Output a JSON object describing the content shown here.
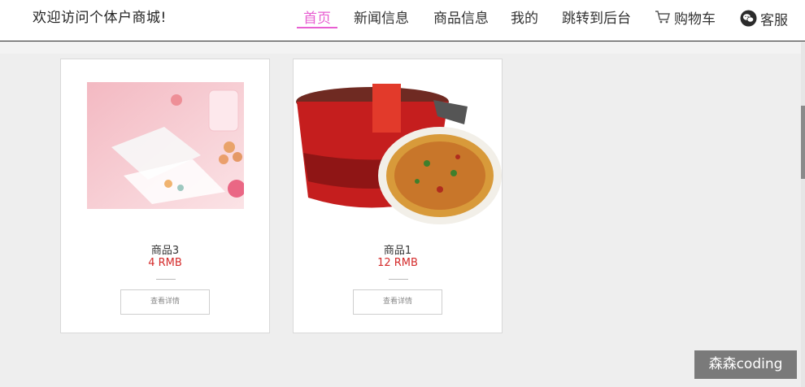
{
  "header": {
    "site_title": "欢迎访问个体户商城!",
    "nav": {
      "home": "首页",
      "news": "新闻信息",
      "products": "商品信息",
      "mine": "我的",
      "admin": "跳转到后台",
      "cart": "购物车",
      "service": "客服"
    },
    "active_color": "#e85fd1"
  },
  "products": [
    {
      "name": "商品3",
      "price": "4 RMB",
      "button": "查看详情"
    },
    {
      "name": "商品1",
      "price": "12 RMB",
      "button": "查看详情"
    }
  ],
  "price_color": "#d42a2a",
  "watermark": "森森coding"
}
